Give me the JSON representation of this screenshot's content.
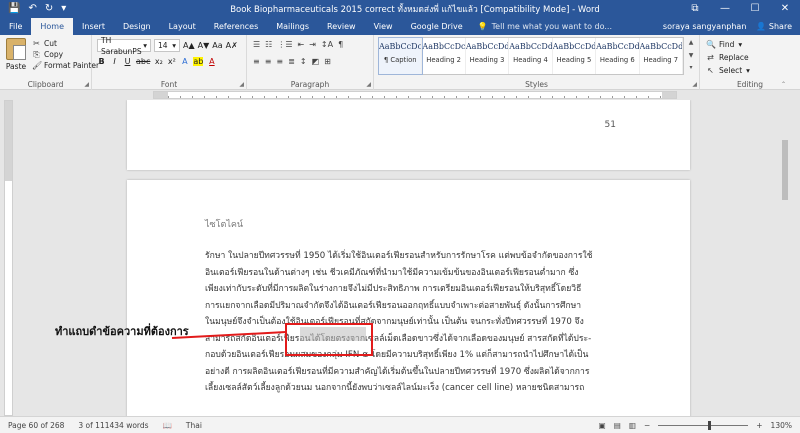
{
  "window": {
    "title": "Book Biopharmaceuticals 2015 correct ทั้งหมดส่งพี่ แก้ไขแล้ว [Compatibility Mode] - Word",
    "controls": {
      "restore": "⧉",
      "minimize": "—",
      "maximize": "☐",
      "close": "✕"
    }
  },
  "qat": {
    "save": "💾",
    "undo": "↶",
    "redo": "↻",
    "customize": "▾"
  },
  "tabs": [
    "File",
    "Home",
    "Insert",
    "Design",
    "Layout",
    "References",
    "Mailings",
    "Review",
    "View",
    "Google Drive"
  ],
  "active_tab": "Home",
  "tell_me": {
    "placeholder": "Tell me what you want to do..."
  },
  "user": {
    "name": "soraya sangyanphan",
    "share_label": "Share"
  },
  "ribbon": {
    "clipboard": {
      "label": "Clipboard",
      "paste": "Paste",
      "cut": "Cut",
      "copy": "Copy",
      "format_painter": "Format Painter"
    },
    "font": {
      "label": "Font",
      "font_name": "TH SarabunPS",
      "font_size": "14",
      "grow": "A▲",
      "shrink": "A▼",
      "case": "Aa",
      "clear": "A✗",
      "bold": "B",
      "italic": "I",
      "underline": "U",
      "strike": "abc",
      "subscript": "x₂",
      "superscript": "x²",
      "text_effects": "A",
      "highlight": "ab",
      "font_color": "A"
    },
    "paragraph": {
      "label": "Paragraph",
      "row1": [
        "☰",
        "☷",
        "⋮☰",
        "⇤",
        "⇥",
        "↕A",
        "¶"
      ],
      "row2": [
        "≡",
        "≡",
        "≡",
        "≣",
        "↕",
        "◩",
        "⊞"
      ]
    },
    "styles": {
      "label": "Styles",
      "items": [
        {
          "sample": "AaBbCcDc",
          "name": "¶ Caption"
        },
        {
          "sample": "AaBbCcDc",
          "name": "Heading 2"
        },
        {
          "sample": "AaBbCcDdEe",
          "name": "Heading 3"
        },
        {
          "sample": "AaBbCcDdEe",
          "name": "Heading 4"
        },
        {
          "sample": "AaBbCcDdEe",
          "name": "Heading 5"
        },
        {
          "sample": "AaBbCcDdEe",
          "name": "Heading 6"
        },
        {
          "sample": "AaBbCcDdEe",
          "name": "Heading 7"
        }
      ]
    },
    "editing": {
      "label": "Editing",
      "find": "Find",
      "replace": "Replace",
      "select": "Select"
    }
  },
  "document": {
    "prev_page_number": "51",
    "section_title": "ไซโตไคน์",
    "lines": [
      "รักษา ในปลายปีทศวรรษที่ 1950 ได้เริ่มใช้อินเตอร์เฟียรอนสำหรับการรักษาโรค แต่พบข้อจำกัดของการใช้",
      "อินเตอร์เฟียรอนในด้านต่างๆ เช่น ชีวเคมีภัณฑ์ที่นำมาใช้มีความเข้มข้นของอินเตอร์เฟียรอนต่ำมาก ซึ่ง",
      "เพียงเท่ากับระดับที่มีการผลิตในร่างกายจึงไม่มีประสิทธิภาพ การเตรียมอินเตอร์เฟียรอนให้บริสุทธิ์โดยวิธี",
      "การแยกจากเลือดมีปริมาณจำกัดจึงได้อินเตอร์เฟียรอนออกฤทธิ์แบบจำเพาะต่อสายพันธุ์ ดังนั้นการศึกษา",
      "ในมนุษย์จึงจำเป็นต้องใช้อินเตอร์เฟียรอนที่สกัดจากมนุษย์เท่านั้น เป็นต้น จนกระทั่งปีทศวรรษที่ 1970 จึง",
      "สามารถสกัดอินเตอร์เฟียรอนได้โดยตรงจากเซลล์เม็ดเลือดขาวซึ่งได้จากเลือดของมนุษย์ สารสกัดที่ได้ประ-",
      "กอบด้วยอินเตอร์เฟียรอนผสมของกลุ่ม IFN-α โดยมีความบริสุทธิ์เพียง 1% แต่ก็สามารถนำไปศึกษาได้เป็น",
      "อย่างดี การผลิตอินเตอร์เฟียรอนที่มีความสำคัญได้เริ่มต้นขึ้นในปลายปีทศวรรษที่ 1970 ซึ่งผลิตได้จากการ",
      "เลี้ยงเซลล์สัตว์เลี้ยงลูกด้วยนม นอกจากนี้ยังพบว่าเซลล์ไลน์มะเร็ง (cancer cell line) หลายชนิดสามารถ"
    ]
  },
  "annotation": {
    "text": "ทำแถบดำข้อความที่ต้องการ",
    "color": "#e21b1b"
  },
  "status": {
    "page": "Page 60 of 268",
    "words": "3 of 111434 words",
    "language": "Thai",
    "zoom": "130%",
    "zoom_minus": "−",
    "zoom_plus": "+"
  },
  "colors": {
    "brand": "#2b579a"
  }
}
